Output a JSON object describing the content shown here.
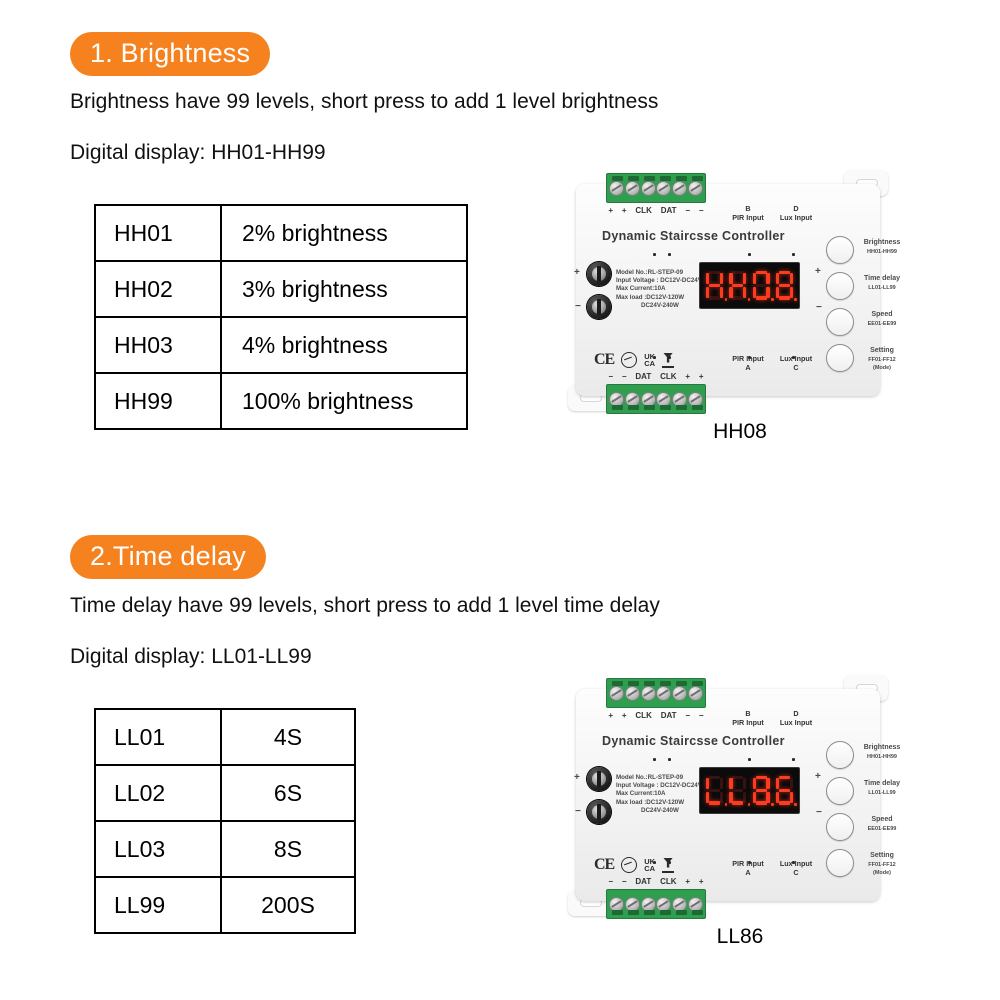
{
  "sections": [
    {
      "badge": "1. Brightness",
      "line1": "Brightness have 99 levels, short press to add 1 level brightness",
      "line2": "Digital display: HH01-HH99",
      "table": {
        "rows": [
          {
            "code": "HH01",
            "value": "2% brightness"
          },
          {
            "code": "HH02",
            "value": "3% brightness"
          },
          {
            "code": "HH03",
            "value": "4% brightness"
          },
          {
            "code": "HH99",
            "value": "100% brightness"
          }
        ]
      },
      "device": {
        "display_value": "HH08",
        "caption": "HH08"
      }
    },
    {
      "badge": "2.Time delay",
      "line1": "Time delay have 99 levels, short press to add 1 level time delay",
      "line2": "Digital display: LL01-LL99",
      "table": {
        "rows": [
          {
            "code": "LL01",
            "value": "4S"
          },
          {
            "code": "LL02",
            "value": "6S"
          },
          {
            "code": "LL03",
            "value": "8S"
          },
          {
            "code": "LL99",
            "value": "200S"
          }
        ]
      },
      "device": {
        "display_value": "LL86",
        "caption": "LL86"
      }
    }
  ],
  "device_common": {
    "title": "Dynamic Staircsse Controller",
    "model_lines": [
      "Model No.:RL-STEP-09",
      "Input Voltage : DC12V-DC24V",
      "Max Current:10A",
      "Max  load :DC12V-120W",
      "DC24V-240W"
    ],
    "top_pins": [
      "+",
      "+",
      "CLK",
      "DAT",
      "−",
      "−"
    ],
    "bottom_pins": [
      "−",
      "−",
      "DAT",
      "CLK",
      "+",
      "+"
    ],
    "io_labels": {
      "b_pir": "B",
      "b_pir_sub": "PIR Input",
      "d_lux": "D",
      "d_lux_sub": "Lux Input",
      "a_pir": "PIR Input",
      "a_pir_sub": "A",
      "c_lux": "Lux Input",
      "c_lux_sub": "C"
    },
    "plus_label": "+",
    "minus_label": "−",
    "buttons": [
      {
        "name": "Brightness",
        "range": "HH01-HH99",
        "extra": ""
      },
      {
        "name": "Time delay",
        "range": "LL01-LL99",
        "extra": ""
      },
      {
        "name": "Speed",
        "range": "EE01-EE99",
        "extra": ""
      },
      {
        "name": "Setting",
        "range": "FF01-FF12",
        "extra": "(Mode)"
      }
    ],
    "certs": {
      "ce": "CE",
      "ukca_top": "UK",
      "ukca_bottom": "CA"
    }
  },
  "colors": {
    "badge_orange": "#F5821F",
    "terminal_green": "#2f9e4f",
    "led_red": "#ff3b1f",
    "panel_white": "#fafafa"
  }
}
